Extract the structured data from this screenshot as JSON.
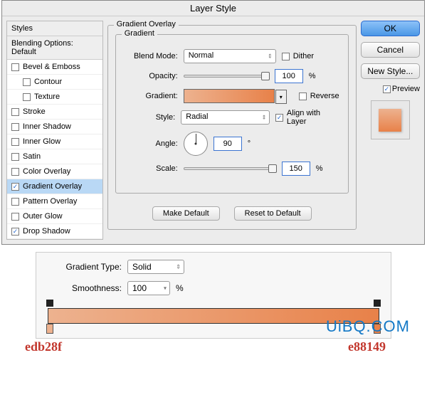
{
  "dialog": {
    "title": "Layer Style",
    "sidebar": {
      "header": "Styles",
      "subheader": "Blending Options: Default",
      "items": [
        {
          "label": "Bevel & Emboss",
          "checked": false,
          "indent": false
        },
        {
          "label": "Contour",
          "checked": false,
          "indent": true
        },
        {
          "label": "Texture",
          "checked": false,
          "indent": true
        },
        {
          "label": "Stroke",
          "checked": false,
          "indent": false
        },
        {
          "label": "Inner Shadow",
          "checked": false,
          "indent": false
        },
        {
          "label": "Inner Glow",
          "checked": false,
          "indent": false
        },
        {
          "label": "Satin",
          "checked": false,
          "indent": false
        },
        {
          "label": "Color Overlay",
          "checked": false,
          "indent": false
        },
        {
          "label": "Gradient Overlay",
          "checked": true,
          "indent": false,
          "selected": true
        },
        {
          "label": "Pattern Overlay",
          "checked": false,
          "indent": false
        },
        {
          "label": "Outer Glow",
          "checked": false,
          "indent": false
        },
        {
          "label": "Drop Shadow",
          "checked": true,
          "indent": false
        }
      ]
    },
    "group": {
      "title": "Gradient Overlay",
      "inner_title": "Gradient",
      "blend_mode_label": "Blend Mode:",
      "blend_mode_value": "Normal",
      "dither_label": "Dither",
      "dither_checked": false,
      "opacity_label": "Opacity:",
      "opacity_value": "100",
      "pct": "%",
      "gradient_label": "Gradient:",
      "reverse_label": "Reverse",
      "reverse_checked": false,
      "style_label": "Style:",
      "style_value": "Radial",
      "align_label": "Align with Layer",
      "align_checked": true,
      "angle_label": "Angle:",
      "angle_value": "90",
      "angle_unit": "°",
      "scale_label": "Scale:",
      "scale_value": "150",
      "make_default": "Make Default",
      "reset_default": "Reset to Default"
    },
    "right": {
      "ok": "OK",
      "cancel": "Cancel",
      "new_style": "New Style...",
      "preview_label": "Preview",
      "preview_checked": true
    }
  },
  "editor": {
    "type_label": "Gradient Type:",
    "type_value": "Solid",
    "smooth_label": "Smoothness:",
    "smooth_value": "100",
    "pct": "%",
    "hex_left": "edb28f",
    "hex_right": "e88149"
  },
  "watermark": "UiBQ.COM"
}
